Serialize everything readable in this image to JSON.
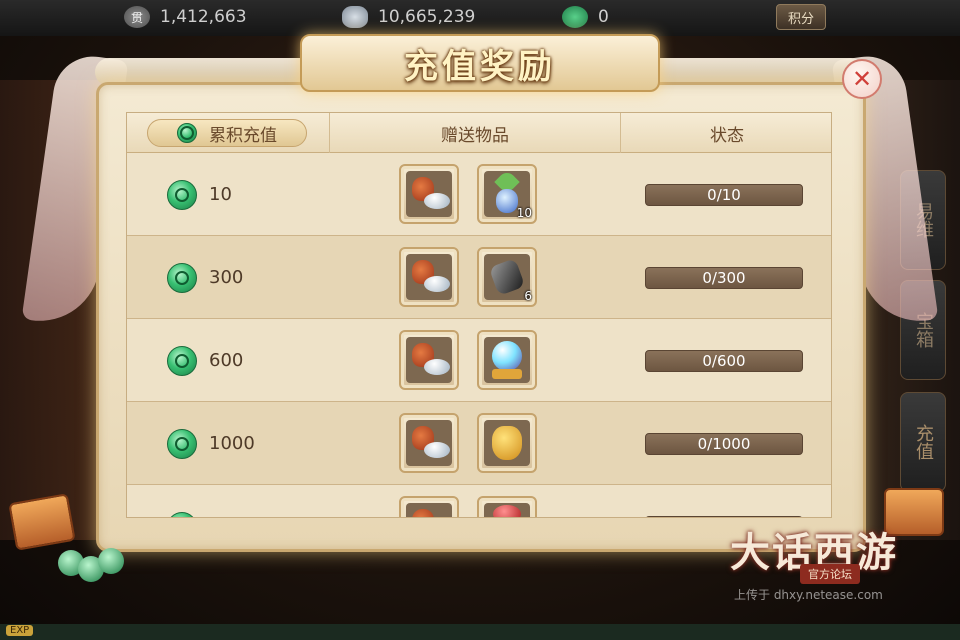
{
  "topbar": {
    "resources": [
      {
        "icon": "tael-icon",
        "value": "1,412,663"
      },
      {
        "icon": "silver-icon",
        "value": "10,665,239"
      },
      {
        "icon": "jade-coin-icon",
        "value": "0"
      }
    ],
    "score_label": "积分"
  },
  "dialog": {
    "title": "充值奖励",
    "columns": {
      "total_recharge": "累积充值",
      "gift_items": "赠送物品",
      "status": "状态"
    },
    "rows": [
      {
        "amount": "10",
        "items": [
          {
            "icon": "gift-bag-icon",
            "qty": ""
          },
          {
            "icon": "vase-item-icon",
            "qty": "10"
          }
        ],
        "status": "0/10"
      },
      {
        "amount": "300",
        "items": [
          {
            "icon": "gift-bag-icon",
            "qty": ""
          },
          {
            "icon": "dark-crystal-icon",
            "qty": "6"
          }
        ],
        "status": "0/300"
      },
      {
        "amount": "600",
        "items": [
          {
            "icon": "gift-bag-icon",
            "qty": ""
          },
          {
            "icon": "crystal-orb-icon",
            "qty": ""
          }
        ],
        "status": "0/600"
      },
      {
        "amount": "1000",
        "items": [
          {
            "icon": "gift-bag-icon",
            "qty": ""
          },
          {
            "icon": "gold-bag-icon",
            "qty": ""
          }
        ],
        "status": "0/1000"
      },
      {
        "amount": "",
        "items": [
          {
            "icon": "gift-bag-icon",
            "qty": ""
          },
          {
            "icon": "red-bag-icon",
            "qty": ""
          }
        ],
        "status": ""
      }
    ]
  },
  "side_tabs": [
    "易维",
    "宝箱",
    "充值"
  ],
  "watermark": {
    "logo": "大话西游",
    "badge": "官方论坛",
    "url": "上传于 dhxy.netease.com"
  },
  "exp_label": "EXP",
  "colors": {
    "accent": "#c9a870",
    "status_bar": "#7d664e",
    "jade": "#38c072"
  }
}
